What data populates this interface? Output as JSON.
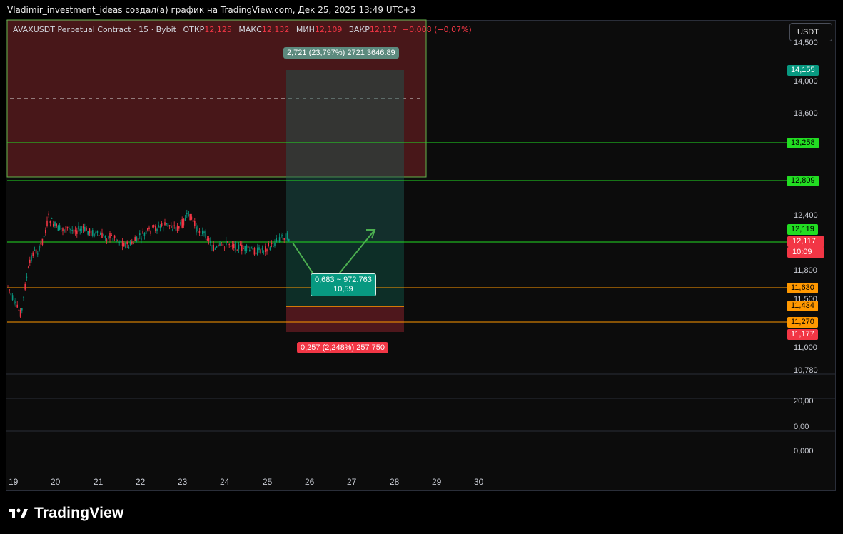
{
  "header": {
    "title": "Vladimir_investment_ideas создал(а) график на TradingView.com, Дек 25, 2025 13:49 UTC+3"
  },
  "symbol": {
    "name": "AVAXUSDT Perpetual Contract · 15 · Bybit",
    "open_label": "ОТКР",
    "open": "12,125",
    "high_label": "МАКС",
    "high": "12,132",
    "low_label": "МИН",
    "low": "12,109",
    "close_label": "ЗАКР",
    "close": "12,117",
    "change": "−0,008 (−0,07%)"
  },
  "currency_button": "USDT",
  "price_axis": {
    "ticks": [
      "14,500",
      "14,000",
      "13,600",
      "12,400",
      "11,800",
      "11,500",
      "11,000",
      "10,780",
      "20,00",
      "0,00",
      "0,000"
    ],
    "tags": [
      {
        "text": "14,155",
        "color": "#089981"
      },
      {
        "text": "13,258",
        "color": "#22dd22"
      },
      {
        "text": "12,809",
        "color": "#22dd22"
      },
      {
        "text": "12,119",
        "color": "#22dd22"
      },
      {
        "text": "12,117",
        "color": "#f23645"
      },
      {
        "text": "10:09",
        "color": "#f23645"
      },
      {
        "text": "11,630",
        "color": "#ff9800"
      },
      {
        "text": "11,434",
        "color": "#ff9800"
      },
      {
        "text": "11,270",
        "color": "#ff9800"
      },
      {
        "text": "11,177",
        "color": "#f23645"
      }
    ]
  },
  "time_axis": {
    "labels": [
      "19",
      "20",
      "21",
      "22",
      "23",
      "24",
      "25",
      "26",
      "27",
      "28",
      "29",
      "30"
    ]
  },
  "position": {
    "target_label": "2,721 (23,797%) 2721 3646.89",
    "mid_label_line1": "0,683 ~ 972.763",
    "mid_label_line2": "10,59",
    "stop_label": "0,257 (2,248%) 257 750"
  },
  "footer": {
    "brand": "TradingView"
  },
  "colors": {
    "green": "#22dd22",
    "orange": "#ff9800",
    "red": "#f23645",
    "teal": "#089981"
  }
}
